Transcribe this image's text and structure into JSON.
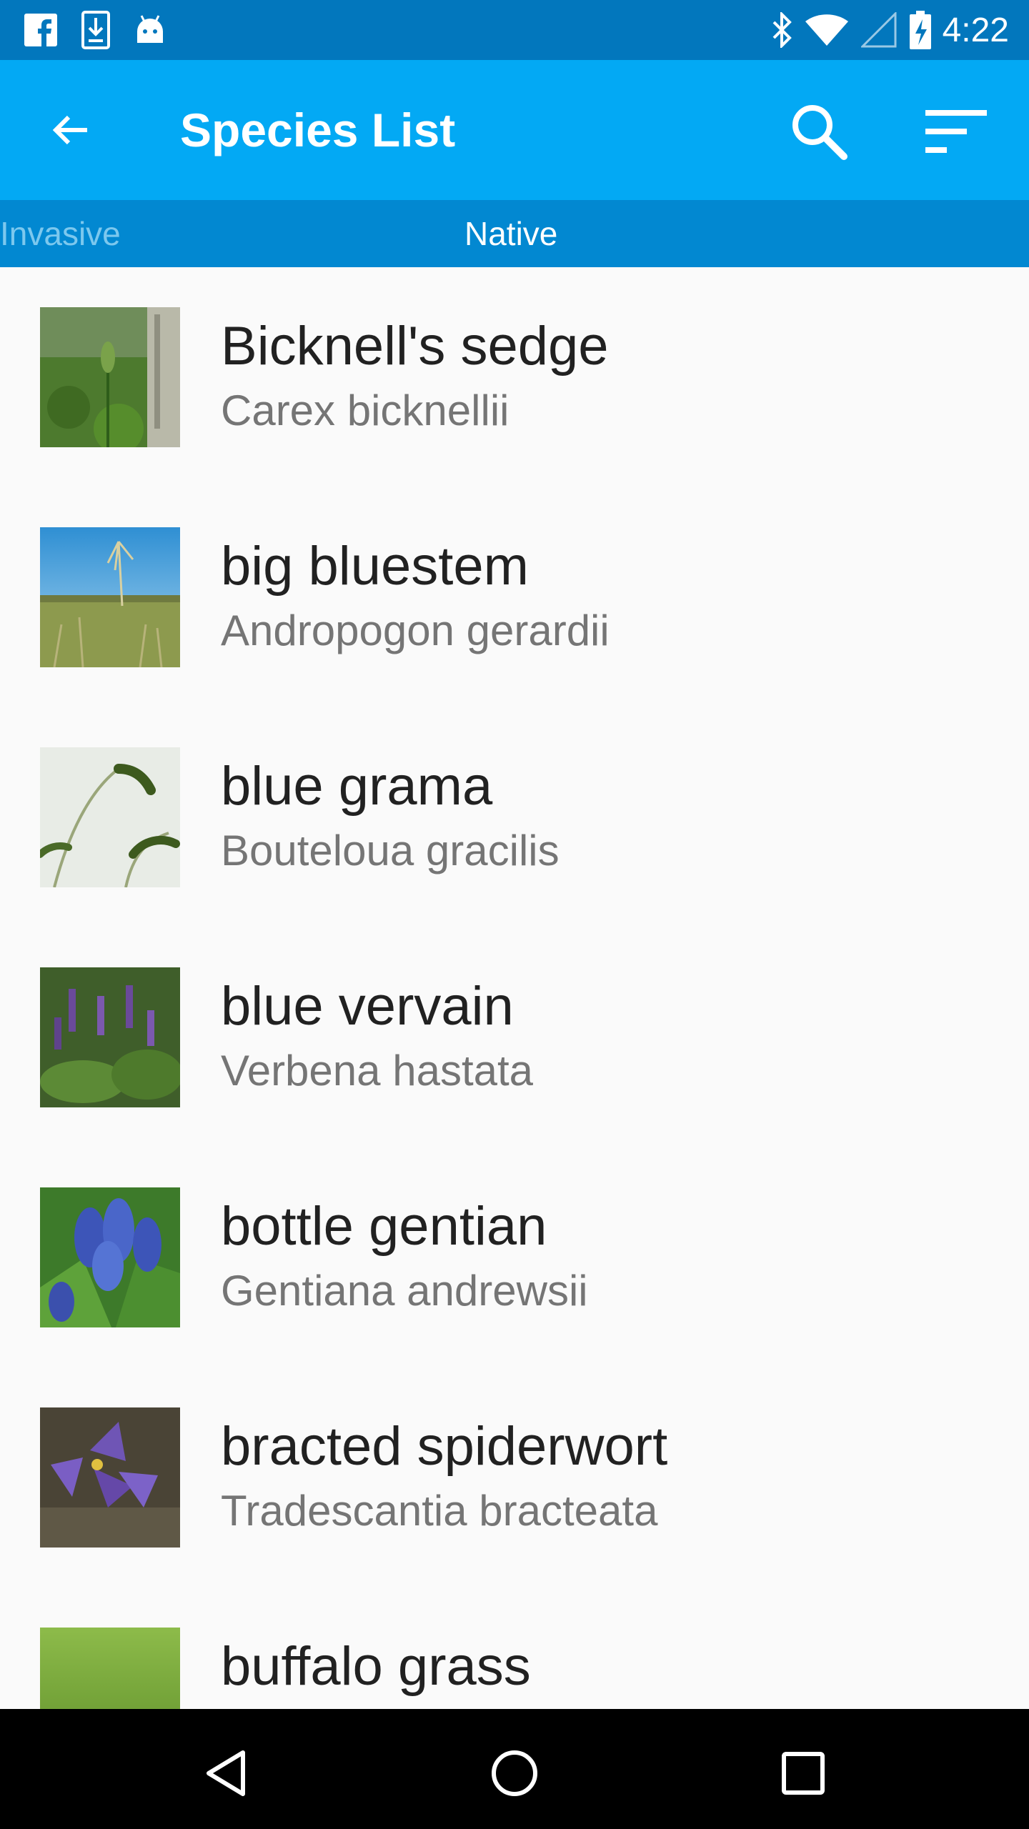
{
  "status_bar": {
    "time": "4:22",
    "left_icons": [
      "facebook-icon",
      "download-icon",
      "android-icon"
    ],
    "right_icons": [
      "bluetooth-icon",
      "wifi-icon",
      "cellular-signal-icon",
      "battery-charging-icon"
    ]
  },
  "app_bar": {
    "title": "Species List",
    "back_icon": "arrow-back-icon",
    "search_icon": "search-icon",
    "sort_icon": "sort-icon",
    "background": "#03a9f4"
  },
  "tabs": [
    {
      "label": "Invasive",
      "selected": false
    },
    {
      "label": "Native",
      "selected": true
    }
  ],
  "species": [
    {
      "common": "Bicknell's sedge",
      "scientific": "Carex bicknellii"
    },
    {
      "common": "big bluestem",
      "scientific": "Andropogon gerardii"
    },
    {
      "common": "blue grama",
      "scientific": "Bouteloua gracilis"
    },
    {
      "common": "blue vervain",
      "scientific": "Verbena hastata"
    },
    {
      "common": "bottle gentian",
      "scientific": "Gentiana andrewsii"
    },
    {
      "common": "bracted spiderwort",
      "scientific": "Tradescantia bracteata"
    },
    {
      "common": "buffalo grass",
      "scientific": ""
    }
  ],
  "nav_bar": {
    "icons": [
      "nav-back-icon",
      "nav-home-icon",
      "nav-recents-icon"
    ]
  },
  "colors": {
    "status_bar": "#0277bd",
    "tab_bar": "#0288d1",
    "tab_selected_text": "#ffffff",
    "tab_unselected_text": "#7cc8ee",
    "primary_text": "#212121",
    "secondary_text": "#757575"
  }
}
